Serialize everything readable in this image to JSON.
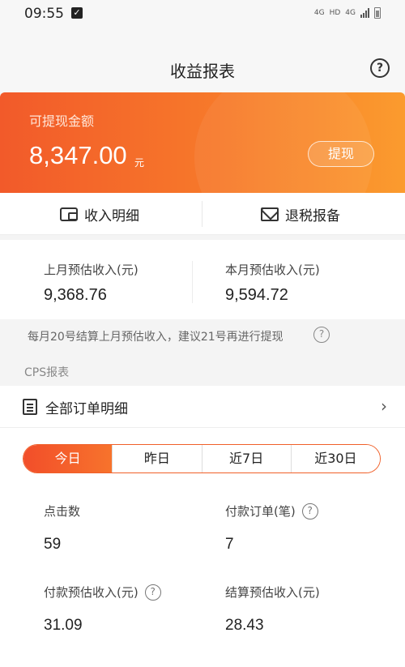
{
  "status_bar": {
    "time": "09:55",
    "net1": "4G",
    "hd": "HD",
    "net2": "4G"
  },
  "nav": {
    "title": "收益报表",
    "help_icon": "question-circle-icon"
  },
  "balance": {
    "label": "可提现金额",
    "amount": "8,347.00",
    "unit": "元",
    "withdraw_label": "提现"
  },
  "actions": {
    "income_detail": "收入明细",
    "tax_report": "退税报备"
  },
  "estimates": {
    "last_month_label": "上月预估收入(元)",
    "last_month_value": "9,368.76",
    "this_month_label": "本月预估收入(元)",
    "this_month_value": "9,594.72"
  },
  "note": "每月20号结算上月预估收入，建议21号再进行提现",
  "cps": {
    "title": "CPS报表",
    "all_orders": "全部订单明细"
  },
  "tabs": [
    "今日",
    "昨日",
    "近7日",
    "近30日"
  ],
  "stats": {
    "clicks_label": "点击数",
    "clicks_value": "59",
    "paid_orders_label": "付款订单(笔)",
    "paid_orders_value": "7",
    "paid_income_label": "付款预估收入(元)",
    "paid_income_value": "31.09",
    "settle_income_label": "结算预估收入(元)",
    "settle_income_value": "28.43"
  },
  "colors": {
    "accent": "#f25a2a",
    "accent_end": "#fb9b2e"
  }
}
